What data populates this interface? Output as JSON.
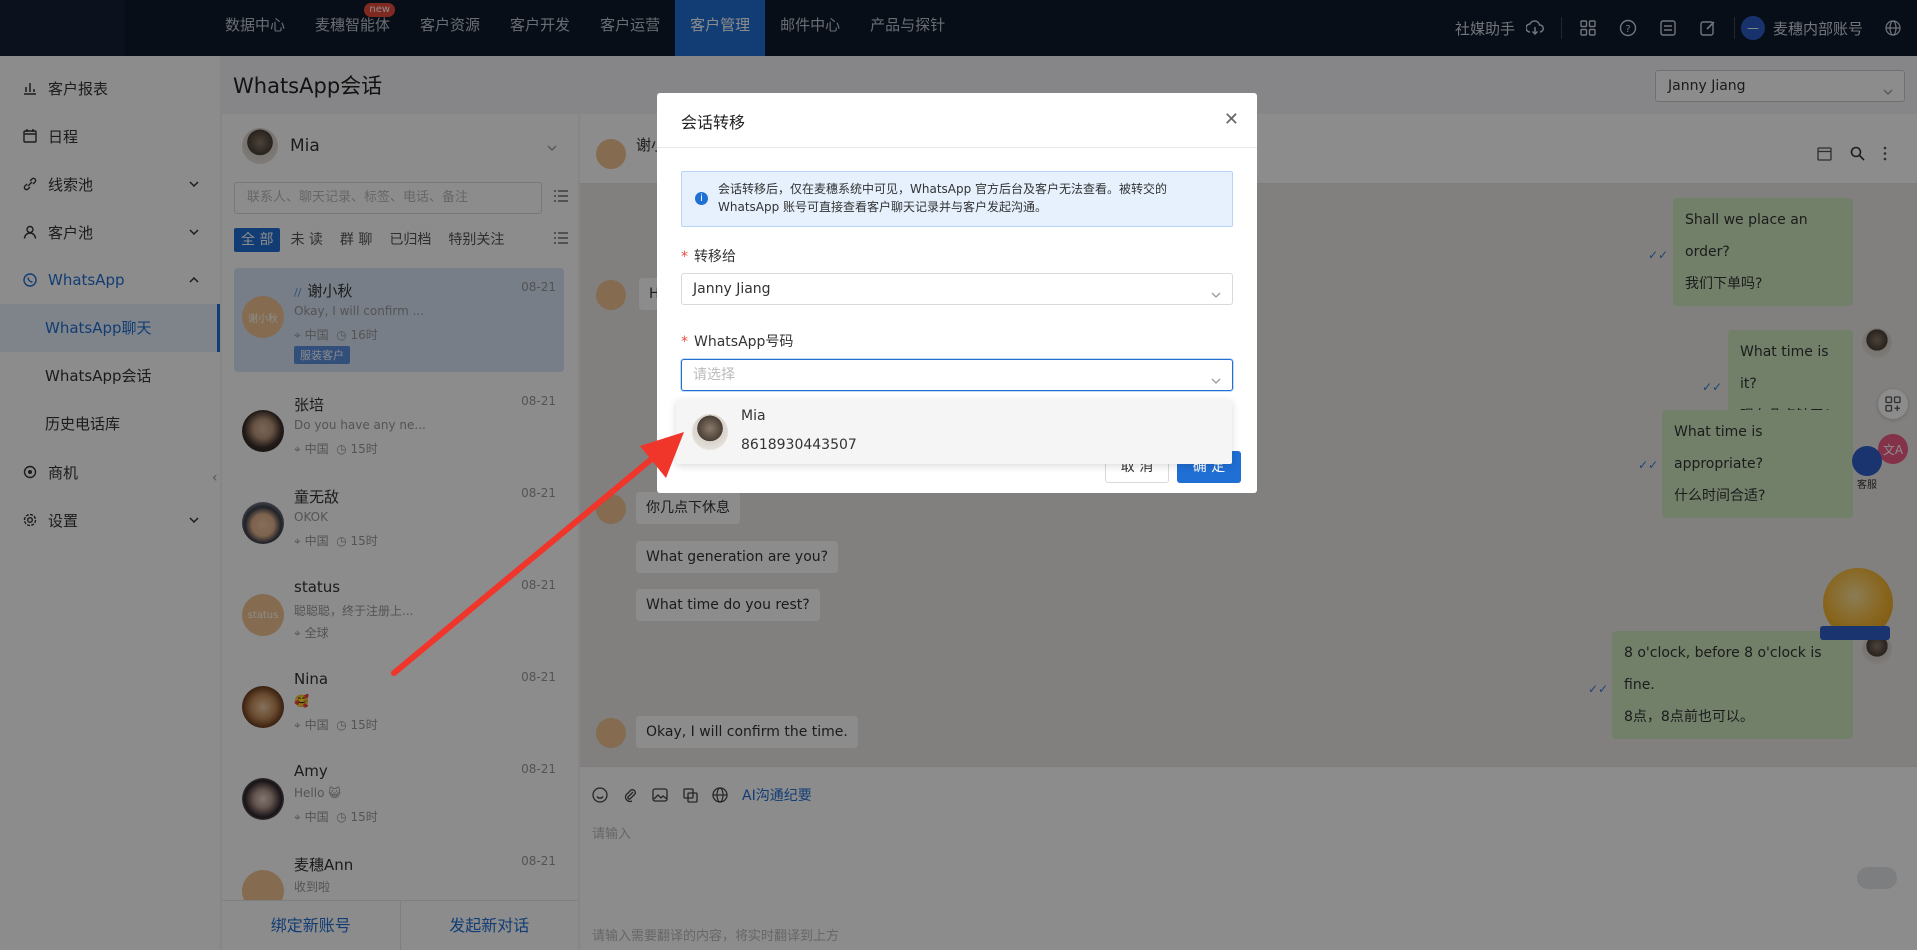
{
  "topnav": {
    "items": [
      "数据中心",
      "麦穗智能体",
      "客户资源",
      "客户开发",
      "客户运营",
      "客户管理",
      "邮件中心",
      "产品与探针"
    ],
    "new_badge": "new",
    "active_index": 5,
    "right_link": "社媒助手",
    "account_name": "麦穗内部账号"
  },
  "sidebar": {
    "items": [
      "客户报表",
      "日程",
      "线索池",
      "客户池",
      "WhatsApp",
      "商机",
      "设置"
    ],
    "whatsapp_sub": [
      "WhatsApp聊天",
      "WhatsApp会话",
      "历史电话库"
    ]
  },
  "page": {
    "title": "WhatsApp会话",
    "agent_selected": "Janny Jiang"
  },
  "chatlist": {
    "account_name": "Mia",
    "search_placeholder": "联系人、聊天记录、标签、电话、备注",
    "filters": [
      "全 部",
      "未 读",
      "群 聊",
      "已归档",
      "特别关注"
    ],
    "conversations": [
      {
        "name": "谢小秋",
        "time": "08-21",
        "msg": "Okay, I will confirm ...",
        "location": "中国",
        "hours": "16时",
        "tag": "服装客户",
        "avatar_text": "谢小秋"
      },
      {
        "name": "张培",
        "time": "08-21",
        "msg": "Do you have any ne...",
        "location": "中国",
        "hours": "15时"
      },
      {
        "name": "童无敌",
        "time": "08-21",
        "msg": "OKOK",
        "location": "中国",
        "hours": "15时"
      },
      {
        "name": "status",
        "time": "08-21",
        "msg": "聪聪聪，终于注册上...",
        "location": "全球",
        "avatar_text": "status"
      },
      {
        "name": "Nina",
        "time": "08-21",
        "msg": "🥰",
        "location": "中国",
        "hours": "15时"
      },
      {
        "name": "Amy",
        "time": "08-21",
        "msg": "Hello 😺",
        "location": "中国",
        "hours": "15时"
      },
      {
        "name": "麦穗Ann",
        "time": "08-21",
        "msg": "收到啦"
      }
    ],
    "footer_bind": "绑定新账号",
    "footer_new": "发起新对话"
  },
  "chat": {
    "contact_name": "谢小",
    "messages_in": [
      "H",
      "你几点下休息",
      "What generation are you?",
      "What time do you rest?",
      "Okay, I will confirm the time."
    ],
    "messages_out": [
      {
        "en": "Shall we place an order?",
        "zh": "我们下单吗?"
      },
      {
        "en": "What time is it?",
        "zh": "现在几点钟了?"
      },
      {
        "en": "What time is appropriate?",
        "zh": "什么时间合适?"
      },
      {
        "en": "8 o'clock, before 8 o'clock is fine.",
        "zh": "8点，8点前也可以。"
      }
    ],
    "ai_link": "AI沟通纪要",
    "input_placeholder": "请输入",
    "translate_placeholder": "请输入需要翻译的内容，将实时翻译到上方",
    "service_label": "客服"
  },
  "modal": {
    "title": "会话转移",
    "info_line1": "会话转移后，仅在麦穗系统中可见，WhatsApp 官方后台及客户无法查看。被转交的",
    "info_line2": "WhatsApp 账号可直接查看客户聊天记录并与客户发起沟通。",
    "field1_label": "转移给",
    "field1_value": "Janny Jiang",
    "field2_label": "WhatsApp号码",
    "field2_placeholder": "请选择",
    "option_name": "Mia",
    "option_number": "8618930443507",
    "cancel": "取 消",
    "ok": "确 定"
  },
  "colors": {
    "accent": "#1f6fd4",
    "topbar": "#101b2d",
    "arrow": "#f0352b"
  }
}
